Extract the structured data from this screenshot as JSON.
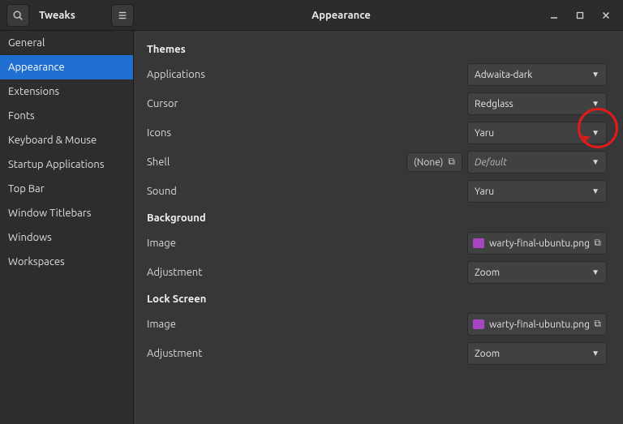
{
  "titlebar": {
    "app_name": "Tweaks",
    "page_title": "Appearance"
  },
  "sidebar": {
    "items": [
      {
        "label": "General"
      },
      {
        "label": "Appearance"
      },
      {
        "label": "Extensions"
      },
      {
        "label": "Fonts"
      },
      {
        "label": "Keyboard & Mouse"
      },
      {
        "label": "Startup Applications"
      },
      {
        "label": "Top Bar"
      },
      {
        "label": "Window Titlebars"
      },
      {
        "label": "Windows"
      },
      {
        "label": "Workspaces"
      }
    ],
    "selected_index": 1
  },
  "sections": {
    "themes": {
      "title": "Themes",
      "rows": {
        "applications": {
          "label": "Applications",
          "value": "Adwaita-dark"
        },
        "cursor": {
          "label": "Cursor",
          "value": "Redglass"
        },
        "icons": {
          "label": "Icons",
          "value": "Yaru"
        },
        "shell": {
          "label": "Shell",
          "none_label": "(None)",
          "value": "Default"
        },
        "sound": {
          "label": "Sound",
          "value": "Yaru"
        }
      }
    },
    "background": {
      "title": "Background",
      "rows": {
        "image": {
          "label": "Image",
          "filename": "warty-final-ubuntu.png"
        },
        "adjustment": {
          "label": "Adjustment",
          "value": "Zoom"
        }
      }
    },
    "lockscreen": {
      "title": "Lock Screen",
      "rows": {
        "image": {
          "label": "Image",
          "filename": "warty-final-ubuntu.png"
        },
        "adjustment": {
          "label": "Adjustment",
          "value": "Zoom"
        }
      }
    }
  }
}
